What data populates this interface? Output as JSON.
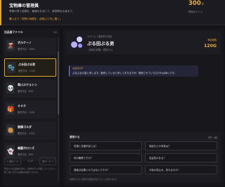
{
  "header": {
    "title": "宝物庫の管理員",
    "description": "専業の買う品物を、最適な手法にて、宝物庫出る者まで。",
    "hint": "購入まで「質問の時間を、経費より先に聞く」",
    "points": "300",
    "points_unit": "G",
    "points_sub": "所持ポイント"
  },
  "sidebar": {
    "title": "出品者ファイル",
    "count": "8人",
    "items": [
      {
        "name": "ボルケーノ",
        "meta": "販売予定 · 180G",
        "icon": "🌋",
        "selected": false
      },
      {
        "name": "ぷる田ぷる男",
        "meta": "販売予定 · 120G",
        "icon": "🫧",
        "selected": true
      },
      {
        "name": "骨川スケルトン",
        "meta": "販売予定 · 90G",
        "icon": "💀",
        "selected": false
      },
      {
        "name": "ミミク",
        "meta": "販売予定 · 150G",
        "icon": "🎁",
        "selected": false
      },
      {
        "name": "鉄鍋ゴルダ",
        "meta": "販売予定 · 200G",
        "icon": "🥘",
        "selected": false
      },
      {
        "name": "幽霊ホロンズ",
        "meta": "販売予定 · 80G",
        "icon": "👻",
        "selected": false
      }
    ],
    "pager": {
      "prev": "← 前ページ",
      "page": "1 / 4",
      "next": "次ページ →"
    },
    "note": "売出人の出品物を選び、質問を行い判断してください。終了後に手元の品物を確認できます。"
  },
  "detail": {
    "category": "スライム / 液体系の商品",
    "name": "ぷる田ぷる男",
    "subtitle": "（商品の詳細：透明さん）",
    "price_label": "希望価格",
    "price": "120G"
  },
  "log": {
    "label": "出品者の声",
    "text": "ぷるぷるの姿と申します。販売していると申しておりますが、販売させていただければ幸いです。"
  },
  "questions": {
    "title": "質問する",
    "count": "残り 4回",
    "items": [
      "性格と流通内容とは？",
      "保証などの有無は？",
      "何の職業ですか？",
      "収益性のある？",
      "態度ほぼ悪いのではないですか？",
      "今後の見込み、売れるのか？"
    ],
    "note": "質問をすると相手の態度が変わることがあります。"
  },
  "colors": {
    "accent": "#e0a32b",
    "selected_border": "#e0a32b",
    "bubble_border": "#8d86e8"
  }
}
